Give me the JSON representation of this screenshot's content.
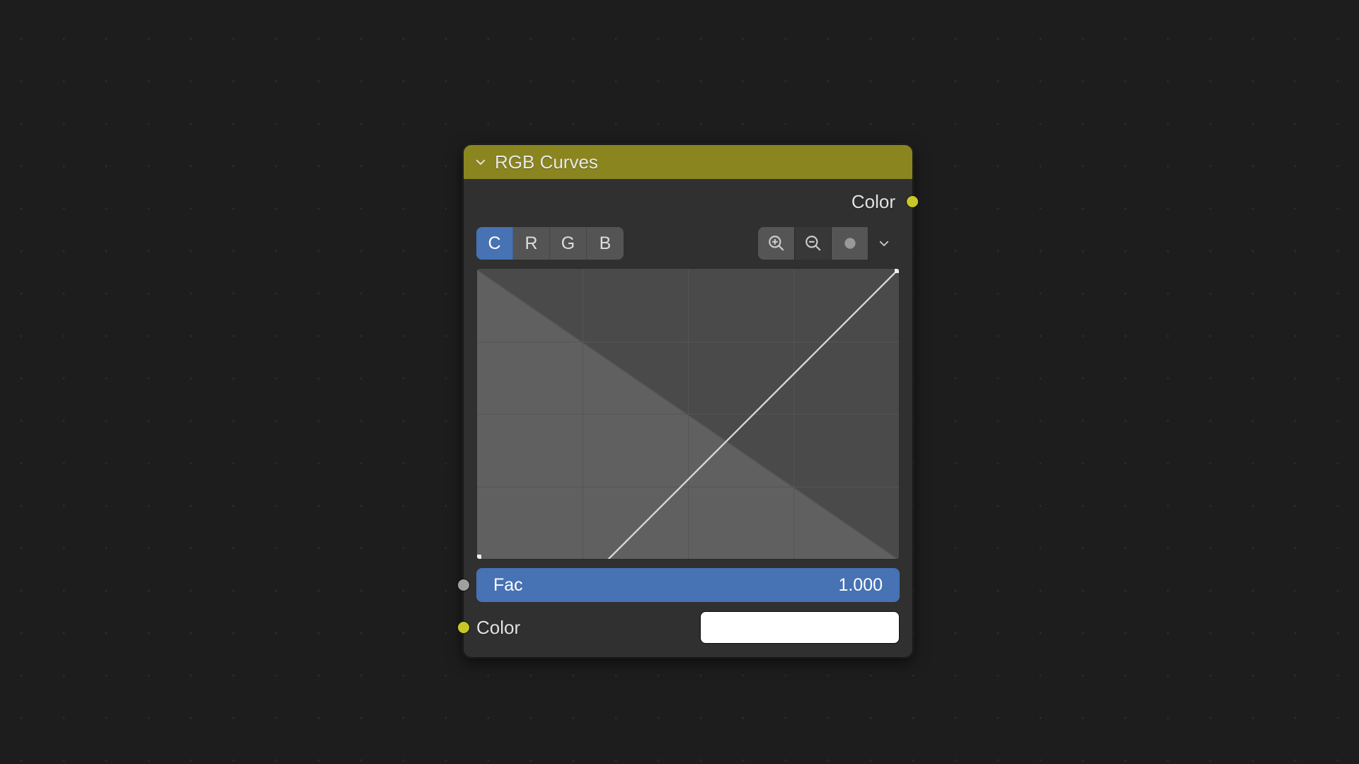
{
  "node": {
    "title": "RGB Curves",
    "output": {
      "label": "Color",
      "socket_color": "#c7c729"
    },
    "channels": [
      "C",
      "R",
      "G",
      "B"
    ],
    "active_channel": "C",
    "tools": {
      "zoom_in": "zoom-in",
      "zoom_out": "zoom-out",
      "clipping": "clipping-dot",
      "menu": "options"
    },
    "fac": {
      "label": "Fac",
      "value": "1.000",
      "socket_color": "#a0a0a0"
    },
    "color_input": {
      "label": "Color",
      "value": "#ffffff",
      "socket_color": "#c7c729"
    }
  },
  "chart_data": {
    "type": "line",
    "title": "",
    "xlabel": "",
    "ylabel": "",
    "x": [
      0.0,
      1.0
    ],
    "values": [
      0.0,
      1.0
    ],
    "xlim": [
      0,
      1
    ],
    "ylim": [
      0,
      1
    ],
    "grid": true
  }
}
